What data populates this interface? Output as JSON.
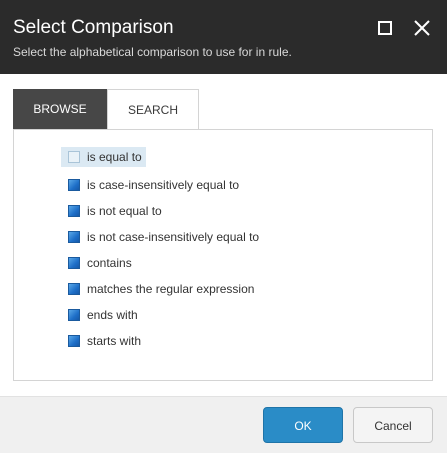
{
  "dialog": {
    "title": "Select Comparison",
    "subtitle": "Select the alphabetical comparison to use for in rule."
  },
  "tabs": [
    {
      "label": "BROWSE",
      "active": true
    },
    {
      "label": "SEARCH",
      "active": false
    }
  ],
  "options": [
    {
      "label": "is equal to",
      "selected": true,
      "icon": "empty-item-icon"
    },
    {
      "label": "is case-insensitively equal to",
      "selected": false,
      "icon": "blue-item-icon"
    },
    {
      "label": "is not equal to",
      "selected": false,
      "icon": "blue-item-icon"
    },
    {
      "label": "is not case-insensitively equal to",
      "selected": false,
      "icon": "blue-item-icon"
    },
    {
      "label": "contains",
      "selected": false,
      "icon": "blue-item-icon"
    },
    {
      "label": "matches the regular expression",
      "selected": false,
      "icon": "blue-item-icon"
    },
    {
      "label": "ends with",
      "selected": false,
      "icon": "blue-item-icon"
    },
    {
      "label": "starts with",
      "selected": false,
      "icon": "blue-item-icon"
    }
  ],
  "footer": {
    "ok_label": "OK",
    "cancel_label": "Cancel"
  },
  "colors": {
    "header_bg": "#2b2b2b",
    "active_tab_bg": "#474747",
    "primary_button": "#2a8cc7",
    "selection_bg": "#dbe9f3"
  }
}
